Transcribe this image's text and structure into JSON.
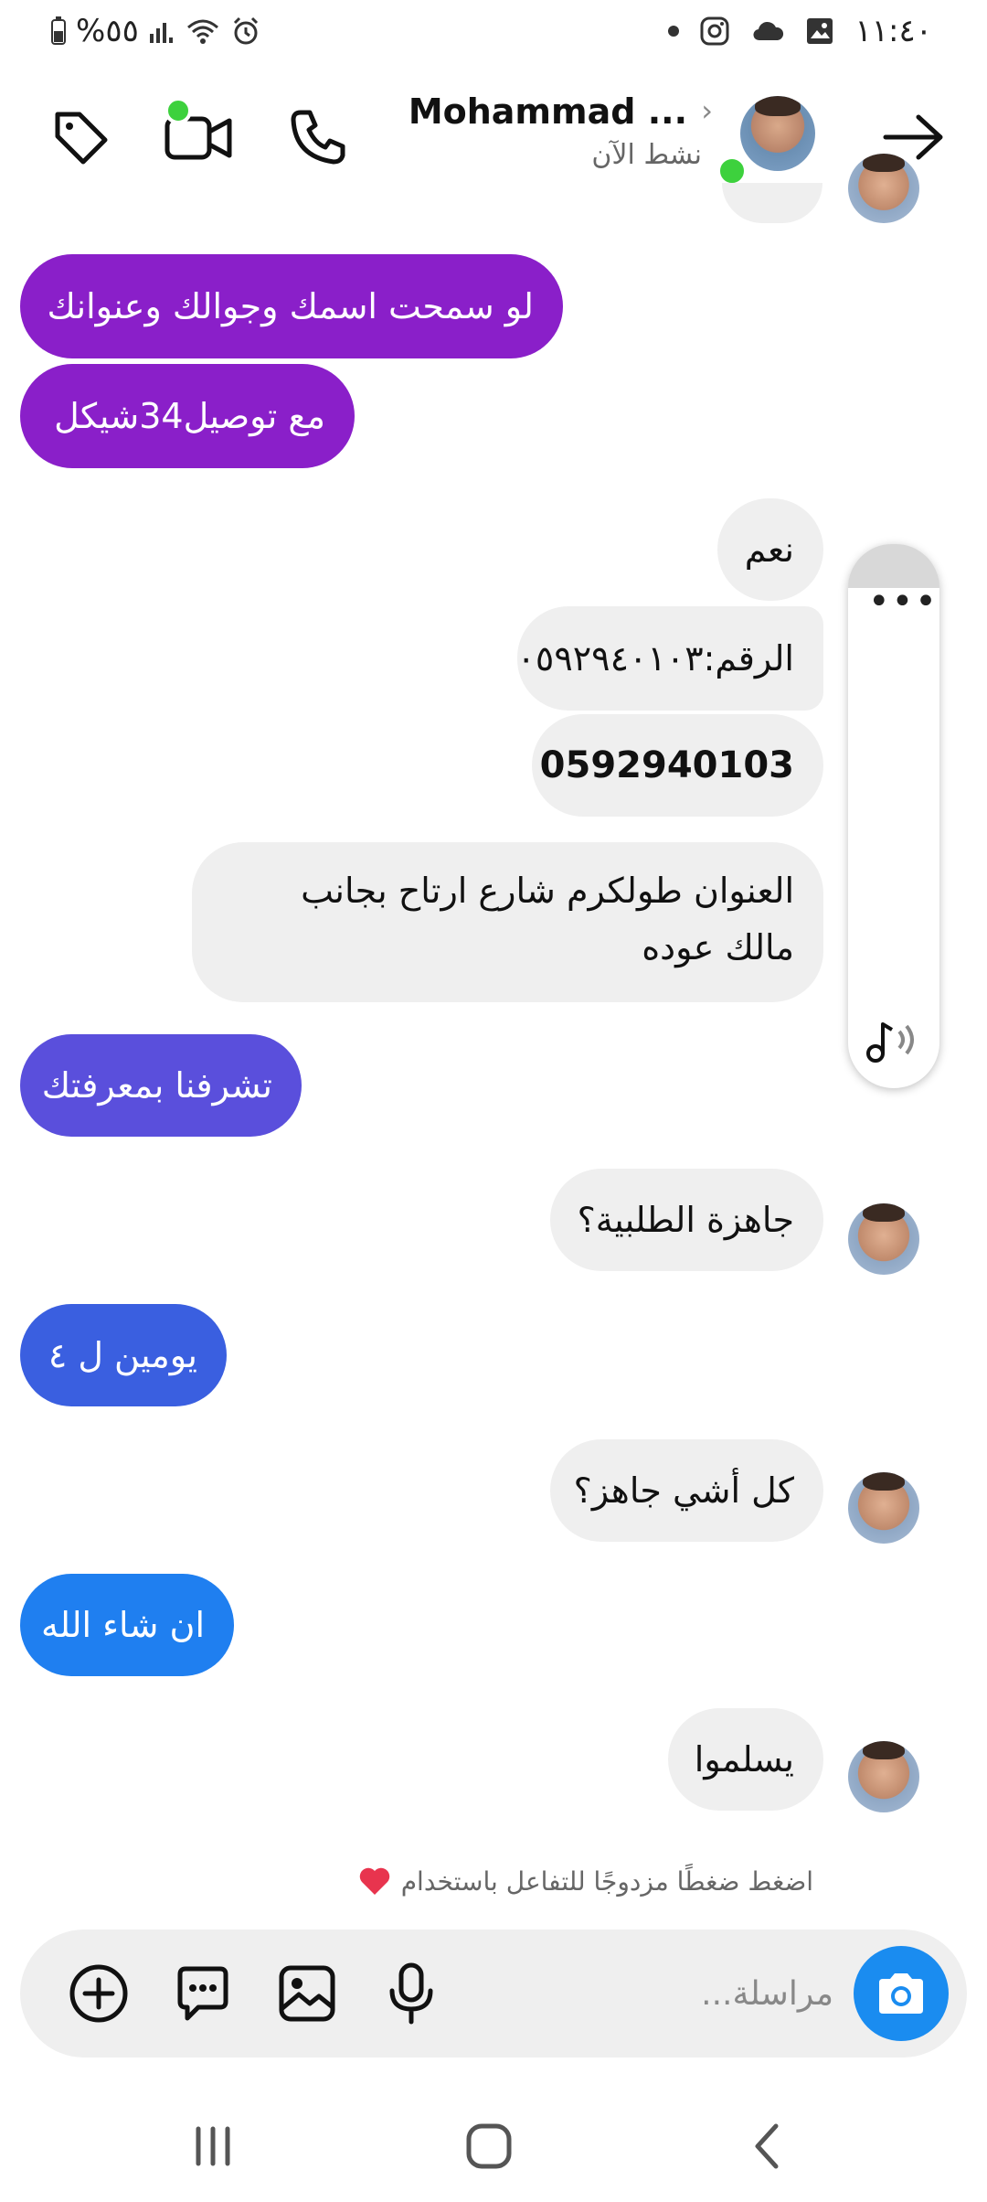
{
  "status_bar": {
    "battery": "%٥٥",
    "time": "١١:٤٠"
  },
  "header": {
    "contact_name": "Mohammad ...",
    "contact_status": "نشط الآن"
  },
  "messages": [
    {
      "text": "لو سمحت اسمك وجوالك وعنوانك",
      "direction": "outgoing",
      "color": "#8a1fc9"
    },
    {
      "text": "مع توصيل34شيكل",
      "direction": "outgoing",
      "color": "#8a1fc9"
    },
    {
      "text": "نعم",
      "direction": "incoming"
    },
    {
      "text": "الرقم:٠٥٩٢٩٤٠١٠٣",
      "direction": "incoming"
    },
    {
      "text": "0592940103",
      "direction": "incoming"
    },
    {
      "text": "العنوان طولكرم شارع ارتاح بجانب مالك عوده",
      "direction": "incoming"
    },
    {
      "text": "تشرفنا بمعرفتك",
      "direction": "outgoing",
      "color": "#5a4fdc"
    },
    {
      "text": "جاهزة الطلبية؟",
      "direction": "incoming"
    },
    {
      "text": "يومين ل ٤",
      "direction": "outgoing",
      "color": "#3a5fe0"
    },
    {
      "text": "كل أشي جاهز؟",
      "direction": "incoming"
    },
    {
      "text": "ان شاء الله",
      "direction": "outgoing",
      "color": "#1f7ff0"
    },
    {
      "text": "يسلموا",
      "direction": "incoming"
    }
  ],
  "side_panel": {
    "more_label": "•••"
  },
  "hint": {
    "text": "اضغط ضغطًا مزدوجًا للتفاعل باستخدام"
  },
  "composer": {
    "placeholder": "مراسلة..."
  },
  "colors": {
    "presence": "#3dd13d",
    "camera_button": "#1a8cf0",
    "incoming_bubble": "#efefef",
    "heart": "#e8344e"
  }
}
